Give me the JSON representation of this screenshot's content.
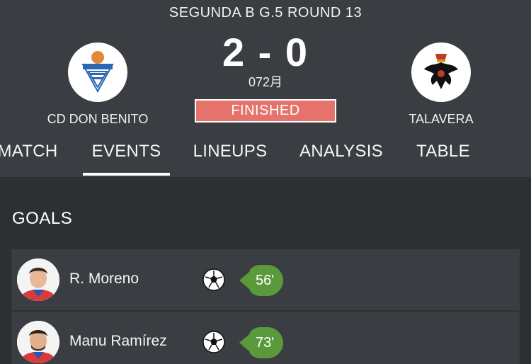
{
  "match": {
    "competition": "SEGUNDA B G.5 ROUND 13",
    "score": "2 - 0",
    "date": "072月",
    "status": "FINISHED",
    "home_team": "CD DON BENITO",
    "away_team": "TALAVERA"
  },
  "tabs": [
    {
      "label": "MATCH"
    },
    {
      "label": "EVENTS",
      "active": true
    },
    {
      "label": "LINEUPS"
    },
    {
      "label": "ANALYSIS"
    },
    {
      "label": "TABLE"
    }
  ],
  "goals": {
    "title": "GOALS",
    "items": [
      {
        "player": "R. Moreno",
        "minute": "56'"
      },
      {
        "player": "Manu Ramírez",
        "minute": "73'"
      }
    ]
  },
  "colors": {
    "header_bg": "#3a3e42",
    "page_bg": "#2c3033",
    "status_bg": "#e5736b",
    "minute_badge": "#5a9a3a"
  },
  "icons": [
    "home-club-crest",
    "away-club-crest",
    "soccer-ball-icon",
    "player-avatar"
  ]
}
